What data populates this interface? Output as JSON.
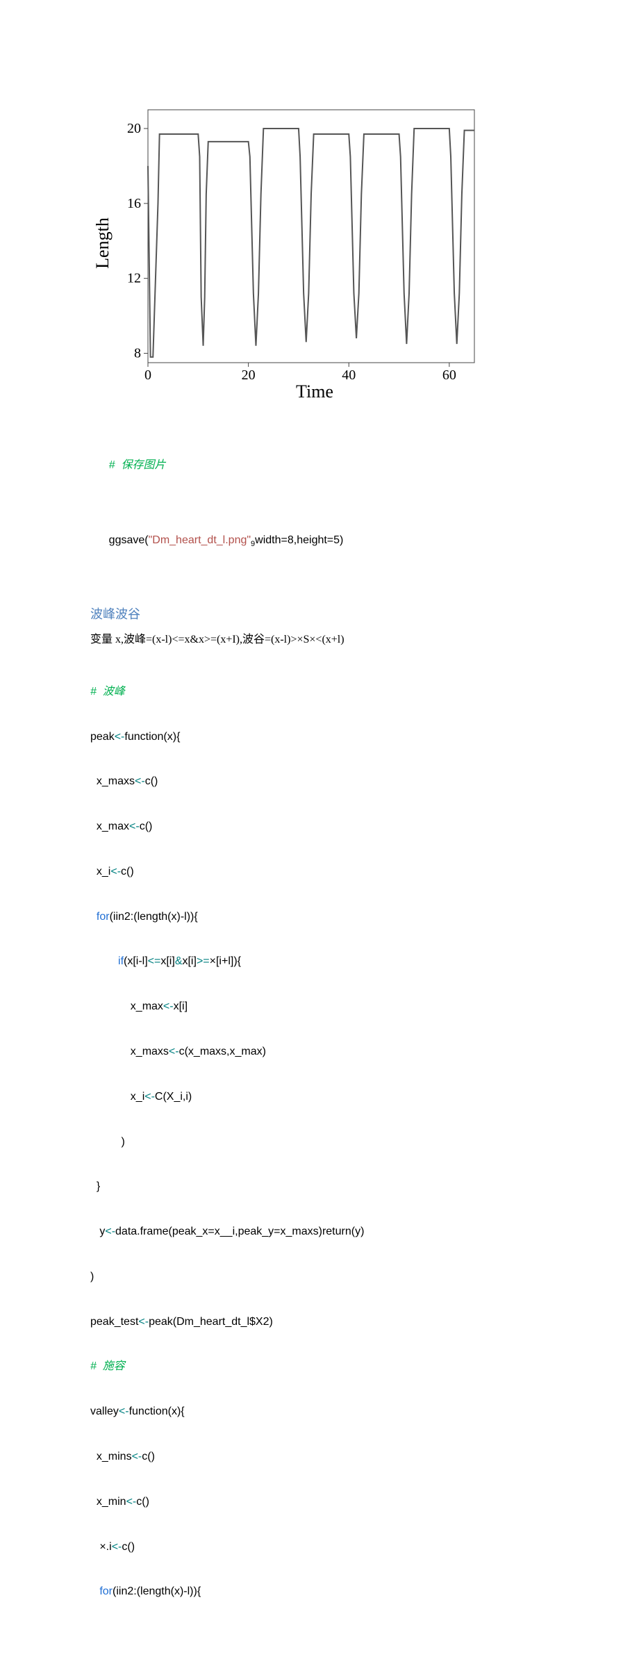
{
  "chart_data": {
    "type": "line",
    "title": "",
    "xlabel": "Time",
    "ylabel": "Length",
    "xlim": [
      0,
      65
    ],
    "ylim": [
      7.5,
      21
    ],
    "x_ticks": [
      0,
      20,
      40,
      60
    ],
    "y_ticks": [
      8,
      12,
      16,
      20
    ],
    "x": [
      0,
      0.5,
      1,
      2,
      2.3,
      2.6,
      10,
      10.3,
      10.6,
      11,
      11.3,
      11.6,
      12,
      12.5,
      13,
      20,
      20.3,
      21,
      21.5,
      22,
      22.5,
      23,
      23.3,
      23.6,
      30,
      30.3,
      31,
      31.5,
      32,
      32.5,
      33,
      33.3,
      33.6,
      40,
      40.3,
      41,
      41.5,
      42,
      42.5,
      43,
      43.3,
      43.6,
      50,
      50.3,
      51,
      51.5,
      52,
      52.5,
      53,
      53.3,
      53.6,
      60,
      60.3,
      61,
      61.5,
      62,
      62.5,
      63,
      63.3,
      63.6,
      65
    ],
    "y": [
      18,
      7.8,
      7.8,
      16,
      19.7,
      19.7,
      19.7,
      18.5,
      11,
      8.4,
      11,
      16.5,
      19.3,
      19.3,
      19.3,
      19.3,
      18.5,
      11.2,
      8.4,
      11.2,
      16.5,
      20,
      20,
      20,
      20,
      18.5,
      11.2,
      8.6,
      11.2,
      16.5,
      19.7,
      19.7,
      19.7,
      19.7,
      18.5,
      11.2,
      8.8,
      11.2,
      16.5,
      19.7,
      19.7,
      19.7,
      19.7,
      18.5,
      11.2,
      8.5,
      11.2,
      16.5,
      20,
      20,
      20,
      20,
      18.5,
      11.2,
      8.5,
      11.2,
      16.5,
      19.9,
      19.9,
      19.9,
      19.9
    ]
  },
  "save_comment": "#  保存图片",
  "save_code_prefix": "ggsave(",
  "save_code_str": "\"Dm_heart_dt_l.png\"",
  "save_code_sub": "9",
  "save_code_rest": "width=8,height=5)",
  "heading": "波峰波谷",
  "body_line": "变量 x,波峰=(x-l)<=x&x>=(x+I),波谷=(x-l)>×S×<(x+l)",
  "peak_comment": "#  波峰",
  "peak_lines": {
    "l1a": "peak",
    "l1b": "<-",
    "l1c": "function(x){",
    "l2a": "  x_maxs",
    "l2b": "<-",
    "l2c": "c()",
    "l3a": "  x_max",
    "l3b": "<-",
    "l3c": "c()",
    "l4a": "  x_i",
    "l4b": "<-",
    "l4c": "c()",
    "l5a": "  for",
    "l5b": "(iin2:(length(x)-l)){",
    "l6a": "         if",
    "l6b": "(x[i-l]",
    "l6c": "<=",
    "l6d": "x[i]",
    "l6e": "&",
    "l6f": "x[i]",
    "l6g": ">=",
    "l6h": "×[i+l]){",
    "l7": "             x_max",
    "l7b": "<-",
    "l7c": "x[i]",
    "l8": "             x_maxs",
    "l8b": "<-",
    "l8c": "c(x_maxs,x_max)",
    "l9": "             x_i",
    "l9b": "<-",
    "l9c": "C(X_i,i)",
    "l10": "          )",
    "l11": "  }",
    "l12a": "   y",
    "l12b": "<-",
    "l12c": "data.frame(peak_x=x__i,peak_y=x_maxs)return(y)",
    "l13": ")",
    "l14a": "peak_test",
    "l14b": "<-",
    "l14c": "peak(Dm_heart_dt_l$X2)"
  },
  "valley_comment": "#  施容",
  "valley_lines": {
    "l1a": "valley",
    "l1b": "<-",
    "l1c": "function(x){",
    "l2a": "  x_mins",
    "l2b": "<-",
    "l2c": "c()",
    "l3a": "  x_min",
    "l3b": "<-",
    "l3c": "c()",
    "l4a": "   ×.i",
    "l4b": "<-",
    "l4c": "c()",
    "l5a": "   for",
    "l5b": "(iin2:(length(x)-l)){"
  }
}
